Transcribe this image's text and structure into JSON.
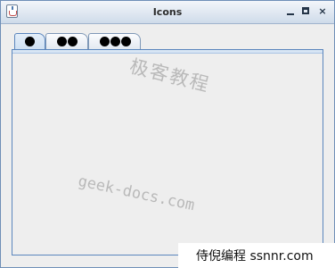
{
  "window": {
    "title": "Icons",
    "icon": "java-cup-icon"
  },
  "controls": {
    "minimize_icon": "minimize-icon",
    "maximize_icon": "maximize-icon",
    "close_icon": "close-icon",
    "close_glyph": "×"
  },
  "tabs": [
    {
      "dots": 1,
      "selected": true
    },
    {
      "dots": 2,
      "selected": false
    },
    {
      "dots": 3,
      "selected": false
    }
  ],
  "watermarks": {
    "top": "极客教程",
    "middle": "geek-docs.com"
  },
  "caption": "侍倪编程 ssnnr.com",
  "colors": {
    "border": "#5b86bd",
    "titlebar_top": "#f3f6fa",
    "titlebar_bottom": "#cfdbea"
  }
}
